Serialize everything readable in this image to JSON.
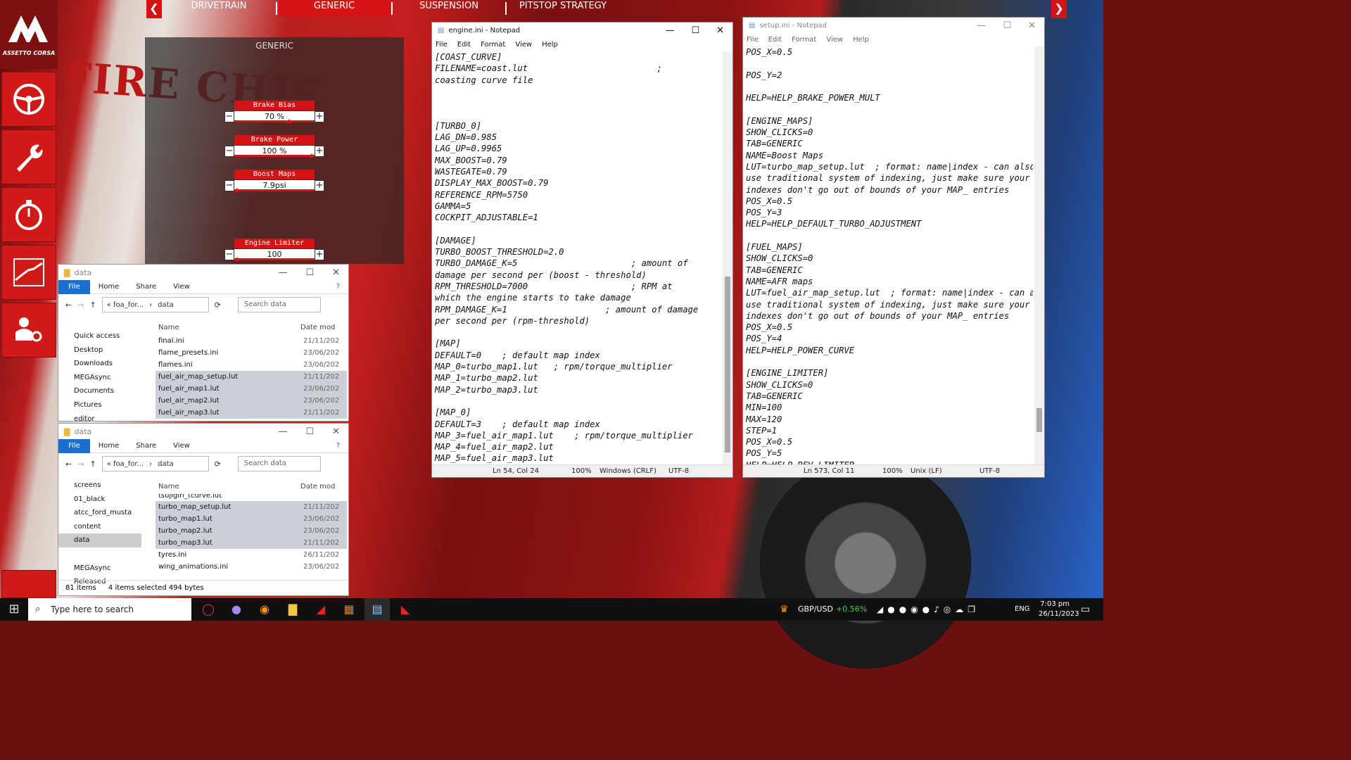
{
  "game": {
    "logo_text": "ASSETTO CORSA",
    "tabs": [
      "DRIVETRAIN",
      "GENERIC",
      "SUSPENSION",
      "PITSTOP STRATEGY"
    ],
    "panel_title": "GENERIC",
    "settings": [
      {
        "label": "Brake Bias",
        "value": "70 %",
        "level": 0.7
      },
      {
        "label": "Brake Power",
        "value": "100 %",
        "level": 1.0
      },
      {
        "label": "Boost Maps",
        "value": "7.9psi",
        "level": 0.0
      },
      {
        "label": "Engine Limiter",
        "value": "100",
        "level": 0.0
      }
    ],
    "bg_text": "FIRE CHIE"
  },
  "explorer1": {
    "title": "data",
    "ribbon": [
      "File",
      "Home",
      "Share",
      "View"
    ],
    "path": [
      "« foa_for...",
      "data"
    ],
    "search_placeholder": "Search data",
    "col_name": "Name",
    "col_date": "Date mod",
    "nav": [
      "Quick access",
      "Desktop",
      "Downloads",
      "MEGAsync",
      "Documents",
      "Pictures",
      "editor"
    ],
    "files": [
      {
        "name": "final.ini",
        "date": "21/11/202",
        "selected": false
      },
      {
        "name": "flame_presets.ini",
        "date": "23/06/202",
        "selected": false
      },
      {
        "name": "flames.ini",
        "date": "23/06/202",
        "selected": false
      },
      {
        "name": "fuel_air_map_setup.lut",
        "date": "21/11/202",
        "selected": true
      },
      {
        "name": "fuel_air_map1.lut",
        "date": "23/06/202",
        "selected": true
      },
      {
        "name": "fuel_air_map2.lut",
        "date": "23/06/202",
        "selected": true
      },
      {
        "name": "fuel_air_map3.lut",
        "date": "21/11/202",
        "selected": true
      }
    ]
  },
  "explorer2": {
    "title": "data",
    "ribbon": [
      "File",
      "Home",
      "Share",
      "View"
    ],
    "path": [
      "« foa_for...",
      "data"
    ],
    "search_placeholder": "Search data",
    "col_name": "Name",
    "col_date": "Date mod",
    "nav": [
      "screens",
      "01_black",
      "atcc_ford_musta",
      "content",
      "data",
      "",
      "MEGAsync",
      "Released"
    ],
    "files": [
      {
        "name": "tsujigiri_tcurve.lut",
        "date": "",
        "selected": false
      },
      {
        "name": "turbo_map_setup.lut",
        "date": "21/11/202",
        "selected": true
      },
      {
        "name": "turbo_map1.lut",
        "date": "23/06/202",
        "selected": true
      },
      {
        "name": "turbo_map2.lut",
        "date": "23/06/202",
        "selected": true
      },
      {
        "name": "turbo_map3.lut",
        "date": "21/11/202",
        "selected": true
      },
      {
        "name": "tyres.ini",
        "date": "26/11/202",
        "selected": false
      },
      {
        "name": "wing_animations.ini",
        "date": "23/06/202",
        "selected": false
      }
    ],
    "status_items": "81 items",
    "status_selected": "4 items selected  494 bytes"
  },
  "notepad1": {
    "title": "engine.ini - Notepad",
    "menu": [
      "File",
      "Edit",
      "Format",
      "View",
      "Help"
    ],
    "text": "[COAST_CURVE]\nFILENAME=coast.lut                         ;\ncoasting curve file\n\n\n\n[TURBO_0]\nLAG_DN=0.985\nLAG_UP=0.9965\nMAX_BOOST=0.79\nWASTEGATE=0.79\nDISPLAY_MAX_BOOST=0.79\nREFERENCE_RPM=5750\nGAMMA=5\nCOCKPIT_ADJUSTABLE=1\n\n[DAMAGE]\nTURBO_BOOST_THRESHOLD=2.0\nTURBO_DAMAGE_K=5                      ; amount of\ndamage per second per (boost - threshold)\nRPM_THRESHOLD=7000                    ; RPM at\nwhich the engine starts to take damage\nRPM_DAMAGE_K=1                   ; amount of damage\nper second per (rpm-threshold)\n\n[MAP]\nDEFAULT=0    ; default map index\nMAP_0=turbo_map1.lut   ; rpm/torque_multiplier\nMAP_1=turbo_map2.lut\nMAP_2=turbo_map3.lut\n\n[MAP_0]\nDEFAULT=3    ; default map index\nMAP_3=fuel_air_map1.lut    ; rpm/torque_multiplier\nMAP_4=fuel_air_map2.lut\nMAP_5=fuel_air_map3.lut",
    "status_pos": "Ln 54, Col 24",
    "status_zoom": "100%",
    "status_eol": "Windows (CRLF)",
    "status_enc": "UTF-8"
  },
  "notepad2": {
    "title": "setup.ini - Notepad",
    "menu": [
      "File",
      "Edit",
      "Format",
      "View",
      "Help"
    ],
    "text": "POS_X=0.5\n\nPOS_Y=2\n\nHELP=HELP_BRAKE_POWER_MULT\n\n[ENGINE_MAPS]\nSHOW_CLICKS=0\nTAB=GENERIC\nNAME=Boost Maps\nLUT=turbo_map_setup.lut  ; format: name|index - can also\nuse traditional system of indexing, just make sure your\nindexes don't go out of bounds of your MAP_ entries\nPOS_X=0.5\nPOS_Y=3\nHELP=HELP_DEFAULT_TURBO_ADJUSTMENT\n\n[FUEL_MAPS]\nSHOW_CLICKS=0\nTAB=GENERIC\nNAME=AFR maps\nLUT=fuel_air_map_setup.lut  ; format: name|index - can also\nuse traditional system of indexing, just make sure your\nindexes don't go out of bounds of your MAP_ entries\nPOS_X=0.5\nPOS_Y=4\nHELP=HELP_POWER_CURVE\n\n[ENGINE_LIMITER]\nSHOW_CLICKS=0\nTAB=GENERIC\nMIN=100\nMAX=120\nSTEP=1\nPOS_X=0.5\nPOS_Y=5\nHELP=HELP_REV_LIMITER",
    "status_pos": "Ln 573, Col 11",
    "status_zoom": "100%",
    "status_eol": "Unix (LF)",
    "status_enc": "UTF-8"
  },
  "taskbar": {
    "search_placeholder": "Type here to search",
    "ticker": "GBP/USD",
    "ticker_change": "+0.56%",
    "lang": "ENG",
    "time": "7:03 pm",
    "date": "26/11/2023"
  },
  "colors": {
    "accent": "#d41414",
    "ticker_up": "#3fd14a"
  }
}
